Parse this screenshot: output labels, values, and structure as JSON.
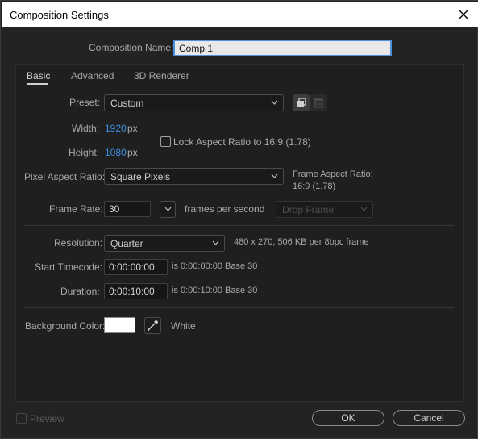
{
  "window": {
    "title": "Composition Settings"
  },
  "composition_name": {
    "label": "Composition Name:",
    "value": "Comp 1"
  },
  "tabs": [
    {
      "label": "Basic",
      "active": true
    },
    {
      "label": "Advanced",
      "active": false
    },
    {
      "label": "3D Renderer",
      "active": false
    }
  ],
  "basic": {
    "preset_label": "Preset:",
    "preset_value": "Custom",
    "width_label": "Width:",
    "width_value": "1920",
    "width_unit": "px",
    "height_label": "Height:",
    "height_value": "1080",
    "height_unit": "px",
    "lock_aspect_label": "Lock Aspect Ratio to 16:9 (1.78)",
    "lock_aspect_checked": false,
    "pixel_aspect_label": "Pixel Aspect Ratio:",
    "pixel_aspect_value": "Square Pixels",
    "frame_aspect_label": "Frame Aspect Ratio:",
    "frame_aspect_value": "16:9 (1.78)",
    "frame_rate_label": "Frame Rate:",
    "frame_rate_value": "30",
    "frame_rate_unit": "frames per second",
    "drop_frame_value": "Drop Frame",
    "resolution_label": "Resolution:",
    "resolution_value": "Quarter",
    "resolution_info": "480 x 270, 506 KB per 8bpc frame",
    "start_tc_label": "Start Timecode:",
    "start_tc_value": "0:00:00:00",
    "start_tc_info": "is 0:00:00:00  Base 30",
    "duration_label": "Duration:",
    "duration_value": "0:00:10:00",
    "duration_info": "is 0:00:10:00  Base 30",
    "bg_color_label": "Background Color:",
    "bg_color_hex": "#FFFFFF",
    "bg_color_name": "White"
  },
  "footer": {
    "preview_label": "Preview",
    "ok_label": "OK",
    "cancel_label": "Cancel"
  },
  "colors": {
    "accent": "#3d8fe0",
    "background": "#232323"
  }
}
